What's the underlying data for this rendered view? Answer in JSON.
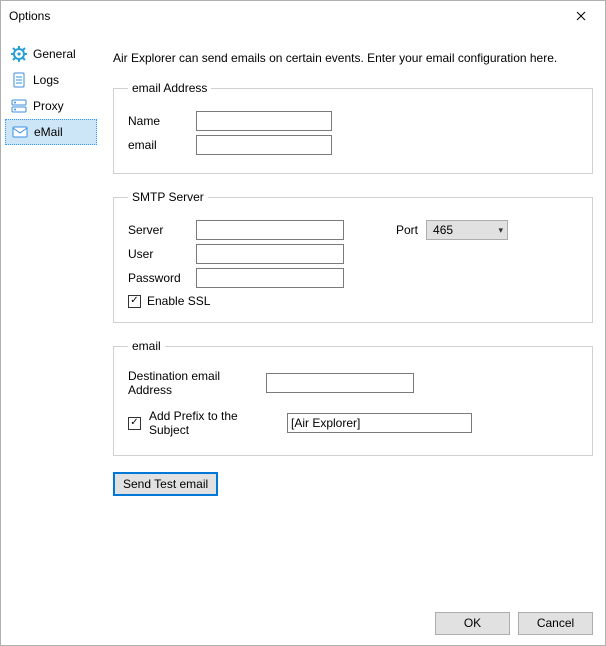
{
  "window": {
    "title": "Options"
  },
  "sidebar": {
    "items": [
      {
        "label": "General"
      },
      {
        "label": "Logs"
      },
      {
        "label": "Proxy"
      },
      {
        "label": "eMail"
      }
    ]
  },
  "main": {
    "description": "Air Explorer can send emails on certain events. Enter your email configuration here.",
    "emailAddress": {
      "legend": "email Address",
      "nameLabel": "Name",
      "nameValue": "",
      "emailLabel": "email",
      "emailValue": ""
    },
    "smtp": {
      "legend": "SMTP Server",
      "serverLabel": "Server",
      "serverValue": "",
      "portLabel": "Port",
      "portValue": "465",
      "userLabel": "User",
      "userValue": "",
      "passwordLabel": "Password",
      "passwordValue": "",
      "enableSslLabel": "Enable SSL",
      "enableSslChecked": true
    },
    "email": {
      "legend": "email",
      "destLabel": "Destination email Address",
      "destValue": "",
      "addPrefixLabel": "Add Prefix to the Subject",
      "addPrefixChecked": true,
      "prefixValue": "[Air Explorer]"
    },
    "sendTestLabel": "Send Test email"
  },
  "footer": {
    "ok": "OK",
    "cancel": "Cancel"
  },
  "glyphs": {
    "check": "✓"
  }
}
